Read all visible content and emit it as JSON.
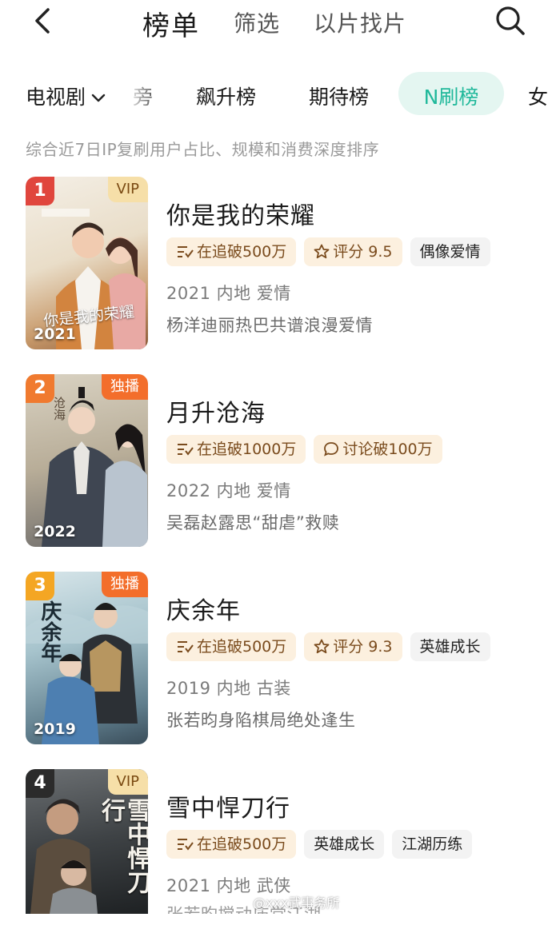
{
  "nav": {
    "title": "榜单",
    "tabs": [
      "筛选",
      "以片找片"
    ]
  },
  "categories": {
    "dropdown": "电视剧",
    "cut_left": "旁",
    "items": [
      "飙升榜",
      "期待榜"
    ],
    "active": "N刷榜",
    "cut_right": "女"
  },
  "description": "综合近7日IP复刷用户占比、规模和消费深度排序",
  "colors": {
    "accent": "#1fb89a",
    "rank1": "#e0463d",
    "rank2": "#f07a2f",
    "rank3": "#f4a623",
    "rank4": "#2b2b2b"
  },
  "items": [
    {
      "rank": "1",
      "badge": "VIP",
      "year": "2021",
      "title": "你是我的荣耀",
      "tags": [
        "在追破500万",
        "评分 9.5",
        "偶像爱情"
      ],
      "meta": "2021 内地 爱情",
      "sub": "杨洋迪丽热巴共谱浪漫爱情",
      "poster_text": "你是我的荣耀"
    },
    {
      "rank": "2",
      "badge": "独播",
      "year": "2022",
      "title": "月升沧海",
      "tags": [
        "在追破1000万",
        "讨论破100万"
      ],
      "meta": "2022 内地 爱情",
      "sub": "吴磊赵露思“甜虐”救赎",
      "poster_text": "沧海"
    },
    {
      "rank": "3",
      "badge": "独播",
      "year": "2019",
      "title": "庆余年",
      "tags": [
        "在追破500万",
        "评分 9.3",
        "英雄成长"
      ],
      "meta": "2019 内地 古装",
      "sub": "张若昀身陷棋局绝处逢生",
      "poster_text": "庆余年"
    },
    {
      "rank": "4",
      "badge": "VIP",
      "year": "",
      "title": "雪中悍刀行",
      "tags": [
        "在追破500万",
        "英雄成长",
        "江湖历练"
      ],
      "meta": "2021 内地 武侠",
      "sub": "张若昀搅动庙堂江湖",
      "poster_text": "雪中悍刀行"
    }
  ],
  "watermark": "@xxx武事务所"
}
